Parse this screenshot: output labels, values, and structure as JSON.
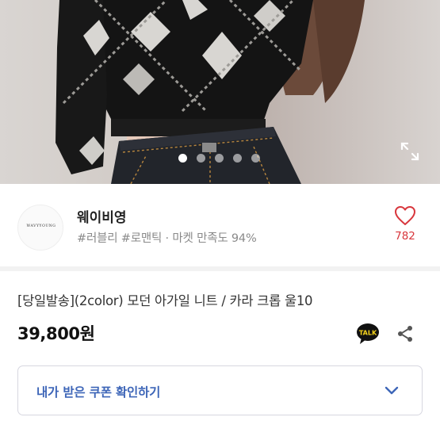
{
  "carousel": {
    "total_slides": 5,
    "active_slide": 1
  },
  "store": {
    "name": "웨이비영",
    "logo_text": "WAVYYOUNG",
    "tags": "#러블리 #로맨틱 · 마켓 만족도 94%",
    "likes": "782"
  },
  "product": {
    "title": "[당일발송](2color) 모던 아가일 니트 / 카라 크롭 울10",
    "price": "39,800원"
  },
  "actions": {
    "talk_badge": "TALK"
  },
  "coupon": {
    "label": "내가 받은 쿠폰 확인하기"
  },
  "colors": {
    "accent_red": "#d8363c",
    "coupon_blue": "#3e66b8",
    "talk_yellow": "#f7d51d"
  },
  "icons": {
    "expand": "expand-icon",
    "heart": "heart-icon",
    "talk": "kakao-talk-icon",
    "share": "share-icon",
    "chevron": "chevron-down-icon"
  }
}
